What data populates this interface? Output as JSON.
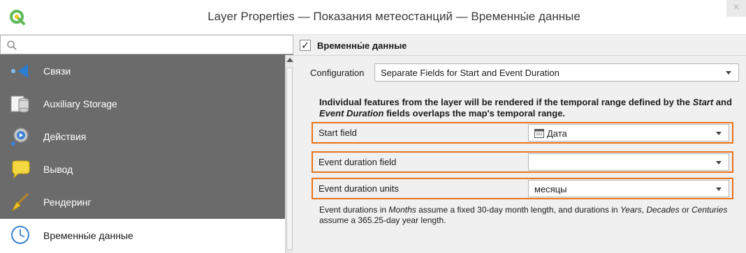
{
  "window": {
    "title": "Layer Properties — Показания метеостанций — Временны́е данные",
    "close_glyph": "×"
  },
  "sidebar": {
    "search_placeholder": "",
    "items": [
      {
        "label": "Связи",
        "icon": "relations-icon"
      },
      {
        "label": "Auxiliary Storage",
        "icon": "auxiliary-storage-icon"
      },
      {
        "label": "Действия",
        "icon": "actions-icon"
      },
      {
        "label": "Вывод",
        "icon": "display-icon"
      },
      {
        "label": "Рендеринг",
        "icon": "rendering-icon"
      },
      {
        "label": "Временны́е данные",
        "icon": "temporal-clock-icon",
        "selected": true
      }
    ]
  },
  "temporal": {
    "group_title": "Временны́е данные",
    "checked_mark": "✓",
    "configuration_label": "Configuration",
    "configuration_value": "Separate Fields for Start and Event Duration",
    "info_1": "Individual features from the layer will be rendered if the temporal range defined by the ",
    "info_start": "Start",
    "info_2": " and ",
    "info_duration": "Event Duration",
    "info_3": " fields overlaps the map's temporal range.",
    "start_field_label": "Start field",
    "start_field_value": "Дата",
    "duration_field_label": "Event duration field",
    "duration_field_value": "",
    "duration_units_label": "Event duration units",
    "duration_units_value": "месяцы",
    "note_1": "Event durations in ",
    "note_months": "Months",
    "note_2": " assume a fixed 30-day month length, and durations in ",
    "note_years": "Years",
    "note_3": ", ",
    "note_decades": "Decades",
    "note_4": " or ",
    "note_centuries": "Centuries",
    "note_5": " assume a 365.25-day year length."
  },
  "colors": {
    "highlight": "#e8731a",
    "sidebar_bg": "#6b6b6b",
    "qgis_green": "#5fb85a"
  }
}
